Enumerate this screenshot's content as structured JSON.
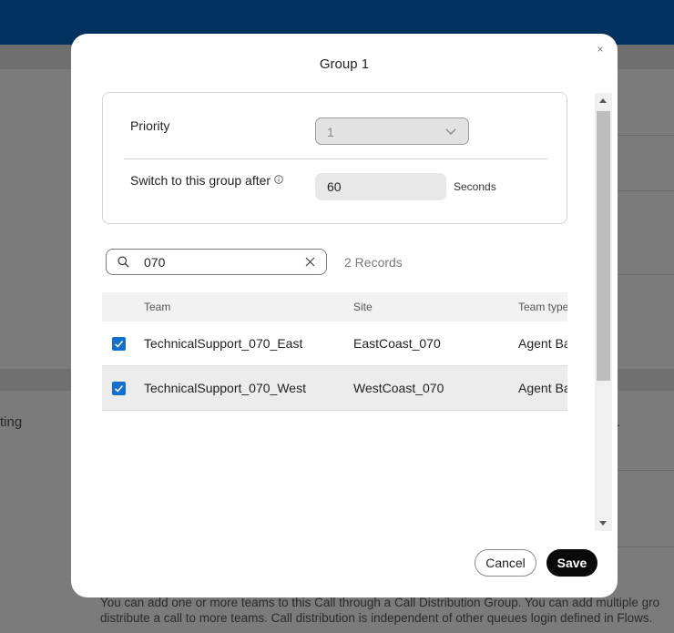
{
  "background": {
    "left_text": "ting",
    "right_text": ".",
    "description_line1": "You can add one or more teams to this Call through a Call Distribution Group. You can add multiple gro",
    "description_line2": "distribute a call to more teams. Call distribution is independent of other queues login defined in Flows."
  },
  "modal": {
    "title": "Group 1",
    "close_symbol": "×",
    "priority": {
      "label": "Priority",
      "value": "1"
    },
    "switch": {
      "label": "Switch to this group after",
      "value": "60",
      "unit": "Seconds"
    },
    "search": {
      "value": "070",
      "records": "2 Records"
    },
    "table": {
      "headers": {
        "team": "Team",
        "site": "Site",
        "team_type": "Team type"
      },
      "rows": [
        {
          "team": "TechnicalSupport_070_East",
          "site": "EastCoast_070",
          "team_type": "Agent Based",
          "checked": true
        },
        {
          "team": "TechnicalSupport_070_West",
          "site": "WestCoast_070",
          "team_type": "Agent Based",
          "checked": true
        }
      ]
    },
    "buttons": {
      "cancel": "Cancel",
      "save": "Save"
    }
  },
  "colors": {
    "accent": "#1170cf",
    "topbar": "#00325f",
    "primary_button": "#0a0a0a"
  }
}
